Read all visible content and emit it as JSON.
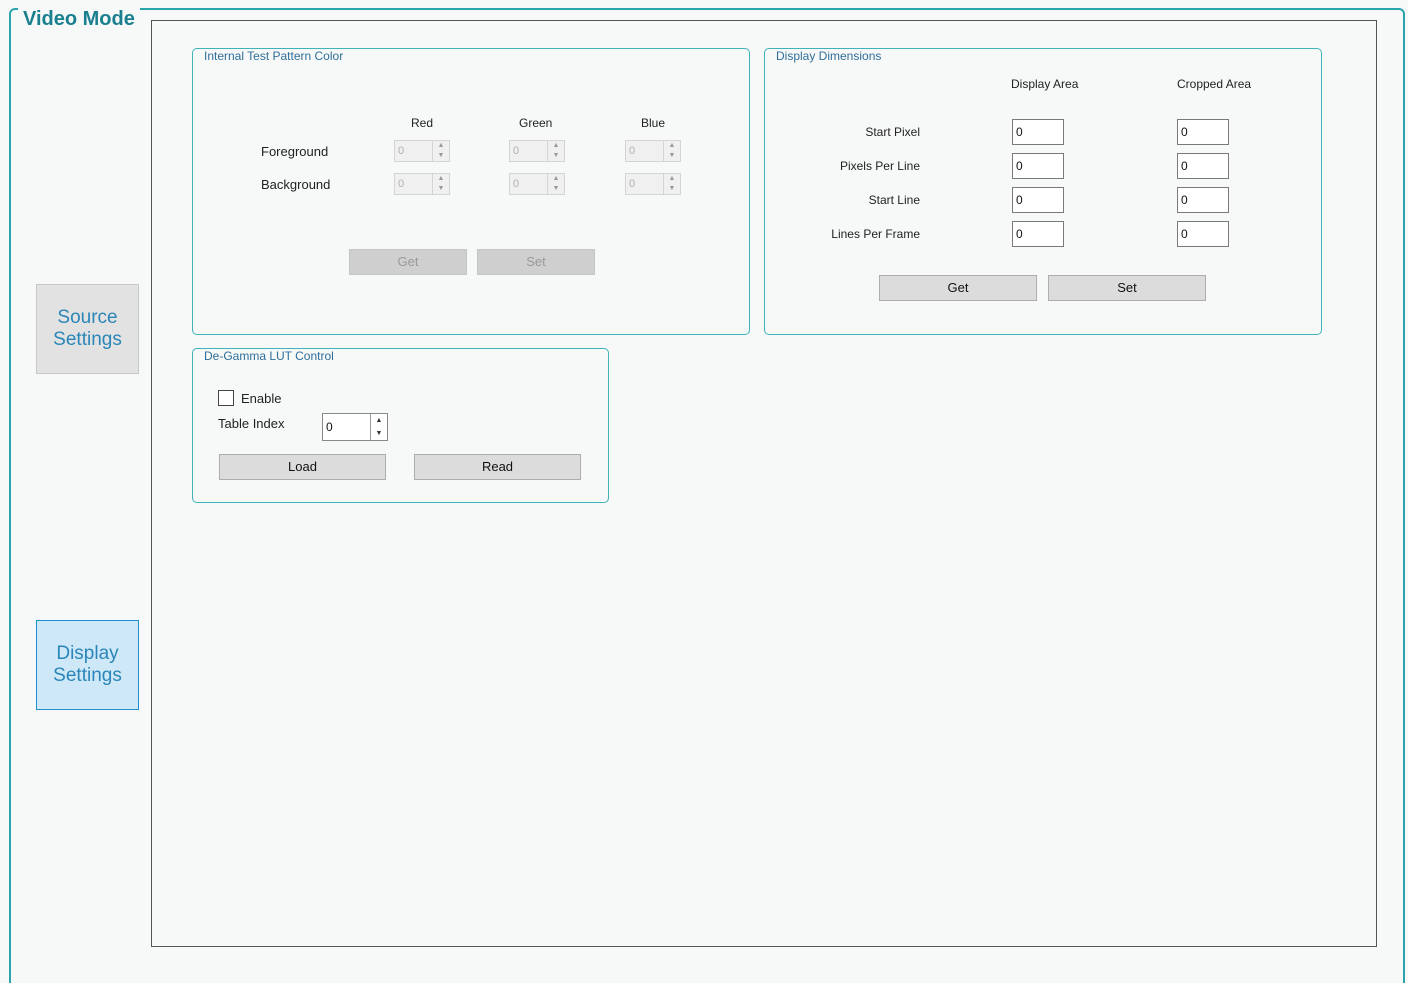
{
  "title": "Video Mode",
  "nav": {
    "source_settings": "Source Settings",
    "display_settings": "Display Settings"
  },
  "internal_test_pattern": {
    "title": "Internal Test Pattern Color",
    "columns": [
      "Red",
      "Green",
      "Blue"
    ],
    "rows": [
      {
        "label": "Foreground",
        "values": [
          "0",
          "0",
          "0"
        ]
      },
      {
        "label": "Background",
        "values": [
          "0",
          "0",
          "0"
        ]
      }
    ],
    "get_label": "Get",
    "set_label": "Set"
  },
  "display_dimensions": {
    "title": "Display Dimensions",
    "columns": [
      "Display Area",
      "Cropped Area"
    ],
    "rows": [
      {
        "label": "Start Pixel",
        "display": "0",
        "cropped": "0"
      },
      {
        "label": "Pixels Per Line",
        "display": "0",
        "cropped": "0"
      },
      {
        "label": "Start Line",
        "display": "0",
        "cropped": "0"
      },
      {
        "label": "Lines Per Frame",
        "display": "0",
        "cropped": "0"
      }
    ],
    "get_label": "Get",
    "set_label": "Set"
  },
  "degamma": {
    "title": "De-Gamma LUT Control",
    "enable_label": "Enable",
    "enable_checked": false,
    "table_index_label": "Table Index",
    "table_index_value": "0",
    "load_label": "Load",
    "read_label": "Read"
  },
  "icons": {
    "spin_up": "▲",
    "spin_down": "▼"
  }
}
